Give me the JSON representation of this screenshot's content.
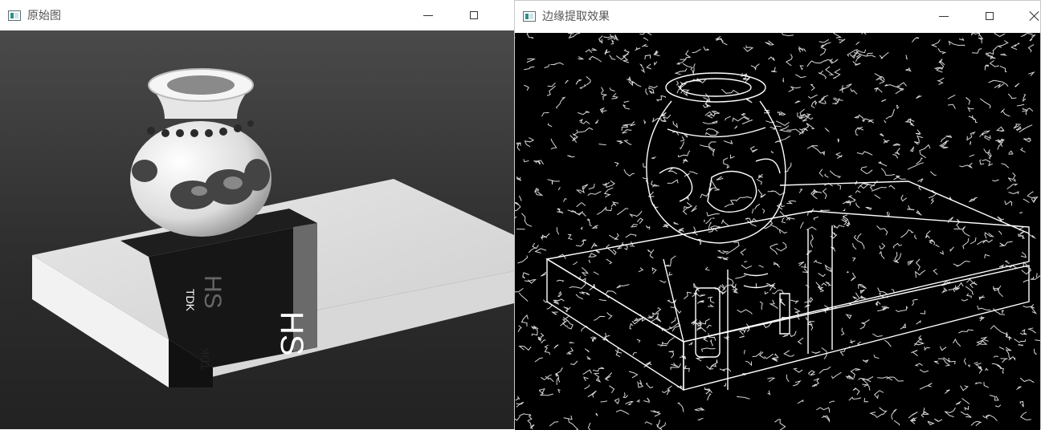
{
  "windows": {
    "original": {
      "title": "原始图",
      "image": {
        "box_label_top": "TDK",
        "box_label_bottom": "TDK",
        "band_text": "HS",
        "band_text_side": "HS"
      }
    },
    "edges": {
      "title": "边缘提取效果"
    }
  },
  "colors": {
    "titlebar_bg": "#ffffff",
    "title_text": "#555555",
    "image_bg": "#2e2e2e",
    "edge_bg": "#000000",
    "edge_line": "#ffffff"
  }
}
